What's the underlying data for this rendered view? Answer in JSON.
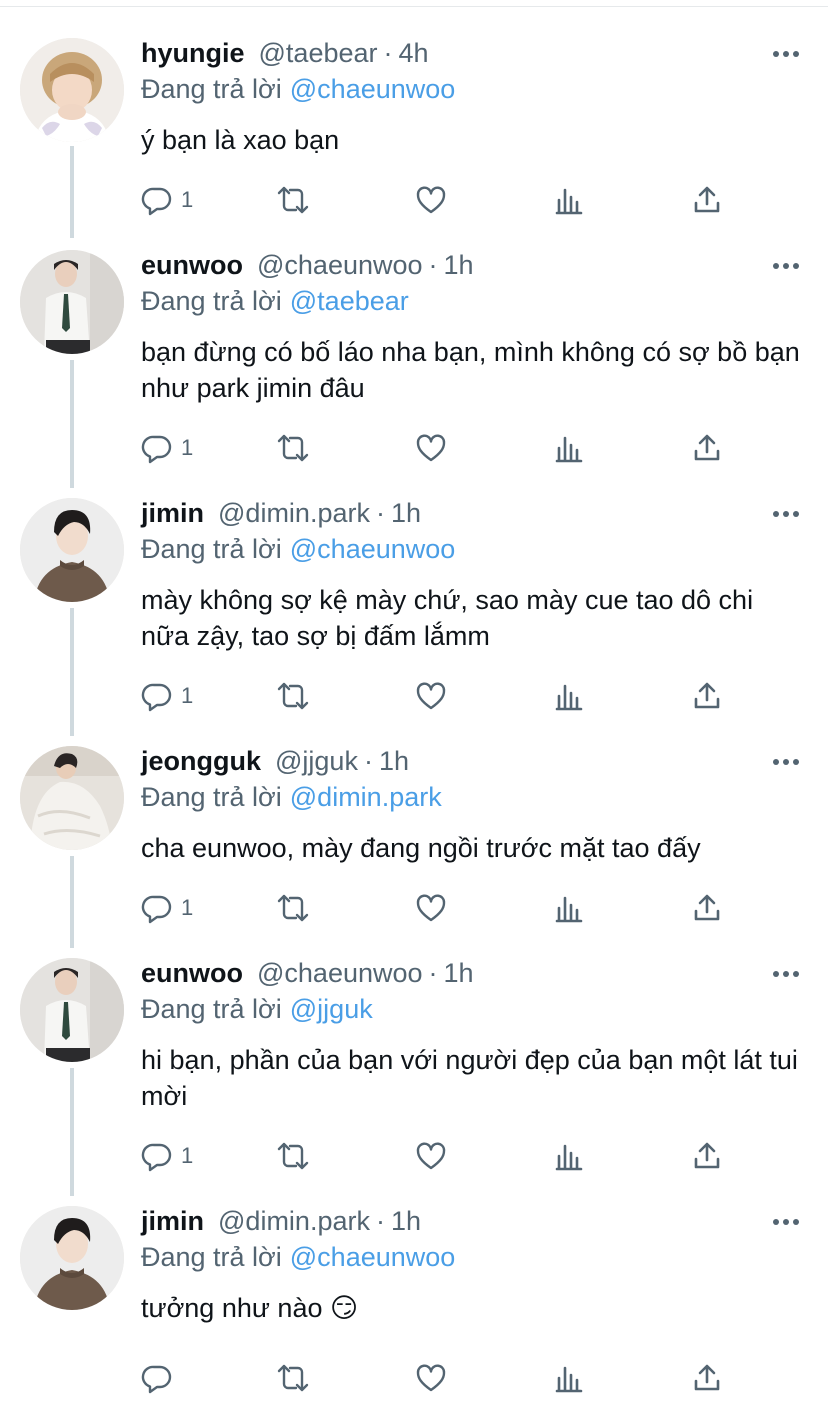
{
  "colors": {
    "link": "#4a9ee6",
    "muted": "#536471",
    "text": "#0f1419",
    "thread": "#cfd9de"
  },
  "reply_prefix": "Đang trả lời",
  "dot": "·",
  "tweets": [
    {
      "name": "hyungie",
      "handle": "@taebear",
      "time": "4h",
      "reply_to": "@chaeunwoo",
      "text": "ý bạn là xao bạn",
      "reply_count": "1",
      "avatar": "hyungie-avatar"
    },
    {
      "name": "eunwoo",
      "handle": "@chaeunwoo",
      "time": "1h",
      "reply_to": "@taebear",
      "text": "bạn đừng có bố láo nha bạn, mình không có sợ bồ bạn như park jimin đâu",
      "reply_count": "1",
      "avatar": "eunwoo-avatar"
    },
    {
      "name": "jimin",
      "handle": "@dimin.park",
      "time": "1h",
      "reply_to": "@chaeunwoo",
      "text": "mày không sợ kệ mày chứ, sao mày cue tao dô chi nữa zậy, tao sợ bị đấm lắmm",
      "reply_count": "1",
      "avatar": "jimin-avatar"
    },
    {
      "name": "jeongguk",
      "handle": "@jjguk",
      "time": "1h",
      "reply_to": "@dimin.park",
      "text": "cha eunwoo, mày đang ngồi trước mặt tao đấy",
      "reply_count": "1",
      "avatar": "jeongguk-avatar"
    },
    {
      "name": "eunwoo",
      "handle": "@chaeunwoo",
      "time": "1h",
      "reply_to": "@jjguk",
      "text": "hi bạn, phần của bạn với người đẹp của bạn một lát tui mời",
      "reply_count": "1",
      "avatar": "eunwoo-avatar"
    },
    {
      "name": "jimin",
      "handle": "@dimin.park",
      "time": "1h",
      "reply_to": "@chaeunwoo",
      "text": "tưởng như nào 😏",
      "reply_count": "",
      "avatar": "jimin-avatar"
    }
  ],
  "icons": [
    "reply-icon",
    "retweet-icon",
    "like-icon",
    "analytics-icon",
    "share-icon",
    "more-icon"
  ]
}
